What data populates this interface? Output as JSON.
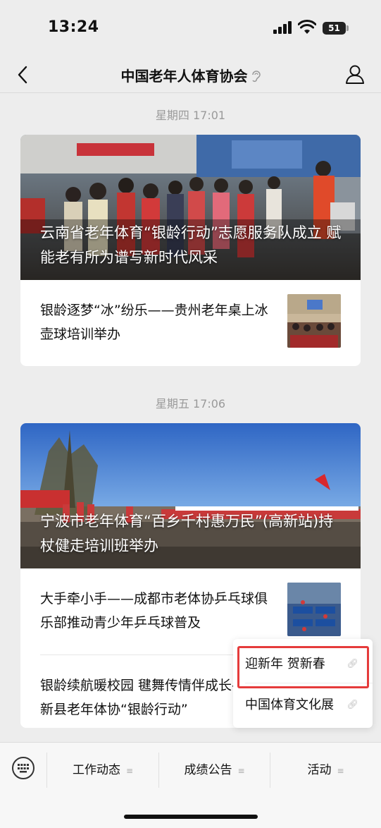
{
  "status": {
    "time": "13:24",
    "battery": "51"
  },
  "nav": {
    "title": "中国老年人体育协会"
  },
  "groups": [
    {
      "timestamp": "星期四 17:01",
      "cover_title": "云南省老年体育“银龄行动”志愿服务队成立 赋能老有所为谱写新时代风采",
      "items": [
        {
          "text": "银龄逐梦“冰”纷乐——贵州老年桌上冰壶球培训举办"
        }
      ]
    },
    {
      "timestamp": "星期五 17:06",
      "cover_title": "宁波市老年体育“百乡千村惠万民”(高新站)持杖健走培训班举办",
      "items": [
        {
          "text": "大手牵小手——成都市老体协乒乓球俱乐部推动青少年乒乓球普及"
        },
        {
          "text": "银龄续航暖校园 毽舞传情伴成长——阳新县老年体协“银龄行动”"
        }
      ]
    }
  ],
  "menu": {
    "items": [
      "工作动态",
      "成绩公告",
      "活动"
    ],
    "submenu": [
      "迎新年 贺新春",
      "中国体育文化展"
    ]
  },
  "colors": {
    "highlight": "#e53b3b",
    "background": "#ededed"
  },
  "icons": [
    "back-icon",
    "ear-icon",
    "profile-icon",
    "keyboard-icon",
    "link-icon"
  ]
}
